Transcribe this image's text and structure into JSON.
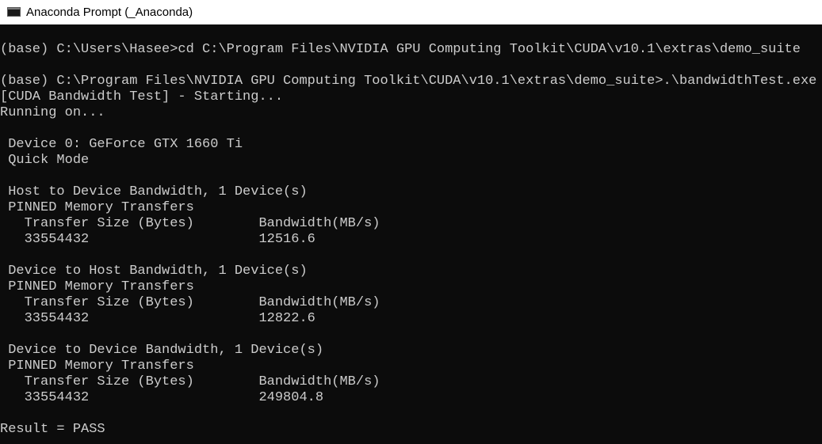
{
  "window": {
    "title": "Anaconda Prompt (_Anaconda)",
    "icon": "console-window-icon"
  },
  "console": {
    "lines": [
      "(base) C:\\Users\\Hasee>cd C:\\Program Files\\NVIDIA GPU Computing Toolkit\\CUDA\\v10.1\\extras\\demo_suite",
      "",
      "(base) C:\\Program Files\\NVIDIA GPU Computing Toolkit\\CUDA\\v10.1\\extras\\demo_suite>.\\bandwidthTest.exe",
      "[CUDA Bandwidth Test] - Starting...",
      "Running on...",
      "",
      " Device 0: GeForce GTX 1660 Ti",
      " Quick Mode",
      "",
      " Host to Device Bandwidth, 1 Device(s)",
      " PINNED Memory Transfers",
      "   Transfer Size (Bytes)        Bandwidth(MB/s)",
      "   33554432                     12516.6",
      "",
      " Device to Host Bandwidth, 1 Device(s)",
      " PINNED Memory Transfers",
      "   Transfer Size (Bytes)        Bandwidth(MB/s)",
      "   33554432                     12822.6",
      "",
      " Device to Device Bandwidth, 1 Device(s)",
      " PINNED Memory Transfers",
      "   Transfer Size (Bytes)        Bandwidth(MB/s)",
      "   33554432                     249804.8",
      "",
      "Result = PASS"
    ]
  }
}
